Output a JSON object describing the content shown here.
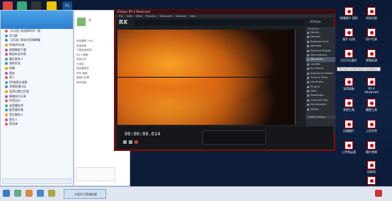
{
  "rx": {
    "title": "iZotope RX 4 Advanced",
    "menu": [
      "File",
      "Edit",
      "View",
      "Process",
      "Transport",
      "Window",
      "Help"
    ],
    "logo": "RX",
    "brand": "iZotope",
    "modules_header": "Modules",
    "modules": [
      "Declip",
      "Declick",
      "Remove Hum",
      "Denoise",
      "Spectral Repair",
      "Deconstruct",
      "Dereverb",
      "Leveler",
      "EQ Match",
      "Ambience Match",
      "Time & Pitch",
      "Loudness",
      "Plug-in",
      "Gain",
      "Resample",
      "Channel Ops",
      "Ds-Ambient",
      "Dither"
    ],
    "selected_module": "Dereverb",
    "time_display": "00:00:00.614",
    "global_history": "Global History"
  },
  "tooltip": "Remove reverb from recording",
  "chat": {
    "tree": [
      "【公告】欢迎新同学一组",
      "学习群",
      "【活动】周末学音频降噪",
      "RX软件交流",
      "视频教程下载",
      "精选好友列表",
      "最近联系人",
      "我的好友",
      "同事",
      "朋友",
      "家人",
      "RX使用交流群",
      "音频处理讨论",
      "混音后期工作室",
      "降噪技巧分享",
      "声音设计",
      "录音棚技术",
      "配音爱好者",
      "音乐制作人",
      "陌生人",
      "黑名单"
    ],
    "tabs": [
      "联系人",
      "群",
      "最近"
    ]
  },
  "conv": {
    "contact": "学",
    "messages": [
      "系统通知 5:42",
      "欢迎使用",
      "下载安装完成",
      "RX 4 教程",
      "收到文件",
      "已发送",
      "请查看附件",
      "好的 谢谢",
      "音频已处理",
      "明天继续"
    ]
  },
  "taskbar": {
    "item_label": "大家学习音频处理"
  },
  "desktop_icons": [
    "网络图片-面积",
    "实际内容",
    "图片-在线",
    "用户目录",
    "1月15日图片",
    "视频处理",
    "宝塔面板",
    "RX 4 Advanced",
    "系统工具",
    "截图工具",
    "压缩图片",
    "上传文件",
    "上传到云盘",
    "图片转换",
    "回收站",
    "文件夹"
  ]
}
